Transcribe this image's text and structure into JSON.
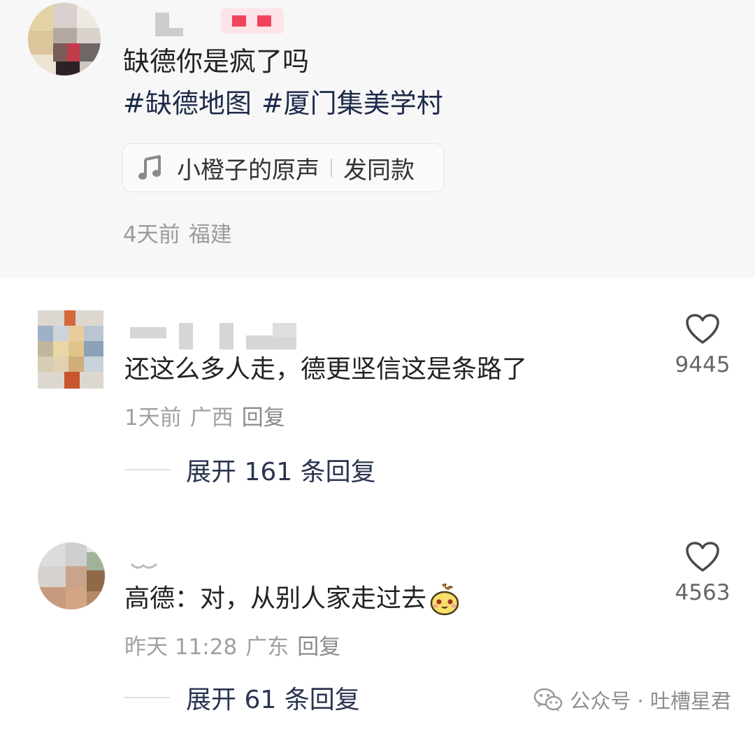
{
  "post": {
    "text": "缺德你是疯了吗",
    "tags": [
      "#缺德地图",
      "#厦门集美学村"
    ],
    "music": {
      "icon": "music-note-icon",
      "title": "小橙子的原声",
      "action": "发同款"
    },
    "meta": {
      "time": "4天前",
      "location": "福建"
    }
  },
  "comments": [
    {
      "text": "还这么多人走，德更坚信这是条路了",
      "time": "1天前",
      "location": "广西",
      "reply_label": "回复",
      "likes": "9445",
      "expand_label": "展开 161 条回复"
    },
    {
      "text": "高德：对，从别人家走过去",
      "emoji": "smiling-face-emoji",
      "time": "昨天 11:28",
      "location": "广东",
      "reply_label": "回复",
      "likes": "4563",
      "expand_label": "展开 61 条回复"
    }
  ],
  "watermark": {
    "icon": "wechat-icon",
    "text": "公众号 · 吐槽星君"
  },
  "colors": {
    "post_background": "#f7f7f7",
    "tag_color": "#1e2a4a",
    "meta_gray": "#9b9b9b",
    "expand_color": "#2a3550"
  }
}
